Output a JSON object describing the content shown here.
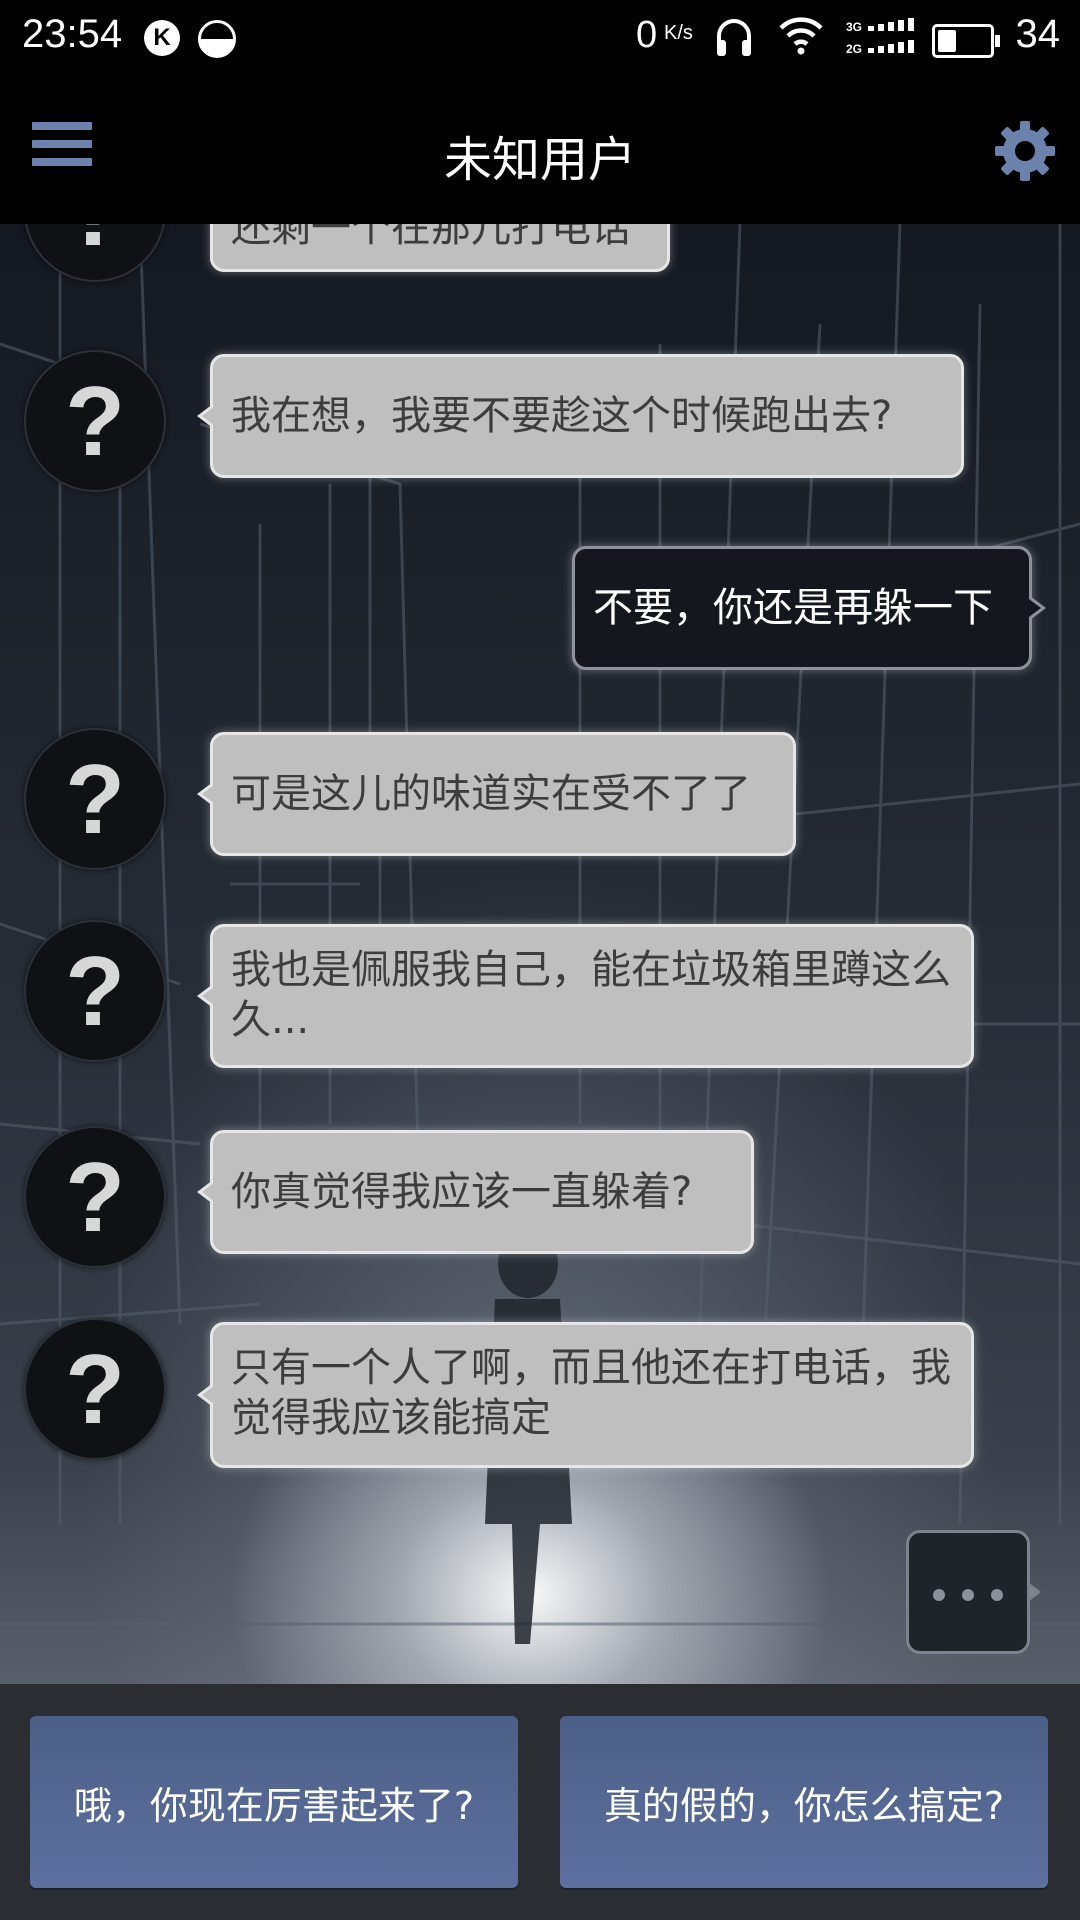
{
  "status_bar": {
    "time": "23:54",
    "k_badge": "K",
    "net_speed": "0",
    "net_speed_unit": "K/s",
    "signal_labels": [
      "3G",
      "2G"
    ],
    "battery": "34"
  },
  "header": {
    "title": "未知用户",
    "menu_icon": "hamburger-menu-icon",
    "settings_icon": "gear-icon"
  },
  "colors": {
    "accent": "#6b82ad",
    "incoming_bubble": "#bfbfbf",
    "outgoing_bubble": "#14171d",
    "choice_button": "#56699a"
  },
  "messages": [
    {
      "side": "left",
      "avatar": "?",
      "text": "还剩一个在那儿打电话"
    },
    {
      "side": "left",
      "avatar": "?",
      "text": "我在想，我要不要趁这个时候跑出去?"
    },
    {
      "side": "right",
      "text": "不要，你还是再躲一下"
    },
    {
      "side": "left",
      "avatar": "?",
      "text": "可是这儿的味道实在受不了了"
    },
    {
      "side": "left",
      "avatar": "?",
      "text": "我也是佩服我自己，能在垃圾箱里蹲这么久..."
    },
    {
      "side": "left",
      "avatar": "?",
      "text": "你真觉得我应该一直躲着?"
    },
    {
      "side": "left",
      "avatar": "?",
      "text": "只有一个人了啊，而且他还在打电话，我觉得我应该能搞定"
    }
  ],
  "choices": [
    {
      "label": "哦，你现在厉害起来了?"
    },
    {
      "label": "真的假的，你怎么搞定?"
    }
  ]
}
